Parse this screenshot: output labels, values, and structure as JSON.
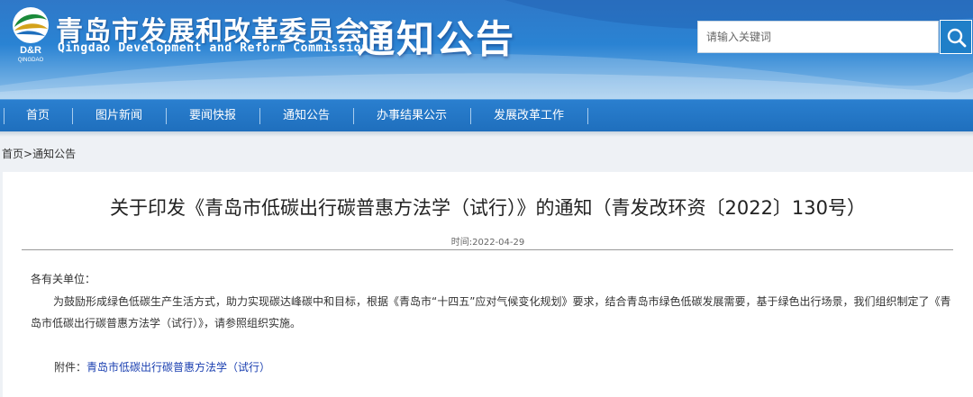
{
  "header": {
    "org_name_cn": "青岛市发展和改革委员会",
    "org_name_en": "Qingdao Development and Reform Commission",
    "logo_text": "D&R",
    "logo_subtext": "QINGDAO",
    "section_title": "通知公告",
    "search_placeholder": "请输入关键词"
  },
  "nav": {
    "items": [
      {
        "label": "首页"
      },
      {
        "label": "图片新闻"
      },
      {
        "label": "要闻快报"
      },
      {
        "label": "通知公告"
      },
      {
        "label": "办事结果公示"
      },
      {
        "label": "发展改革工作"
      }
    ]
  },
  "breadcrumb": {
    "home": "首页",
    "separator": ">",
    "current": "通知公告"
  },
  "article": {
    "title": "关于印发《青岛市低碳出行碳普惠方法学（试行）》的通知（青发改环资〔2022〕130号）",
    "time_label": "时间:",
    "time": "2022-04-29",
    "salutation": "各有关单位：",
    "body": "为鼓励形成绿色低碳生产生活方式，助力实现碳达峰碳中和目标，根据《青岛市“十四五”应对气候变化规划》要求，结合青岛市绿色低碳发展需要，基于绿色出行场景，我们组织制定了《青岛市低碳出行碳普惠方法学（试行）》，请参照组织实施。",
    "attachment_label": "附件：",
    "attachment_link": "青岛市低碳出行碳普惠方法学（试行）"
  },
  "colors": {
    "banner_top": "#2f78c8",
    "nav_bg": "#1f6fbd",
    "link": "#1a3fb0",
    "search_button": "#1f7fc8"
  }
}
